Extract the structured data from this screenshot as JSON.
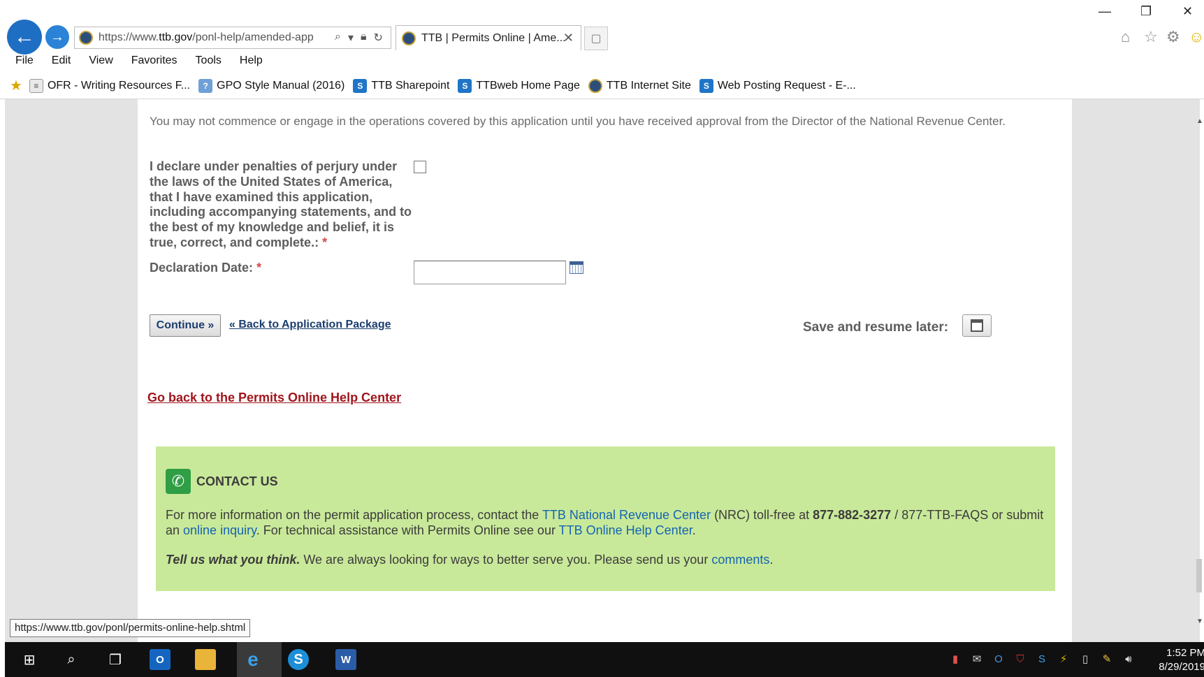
{
  "browser": {
    "url_prefix": "https://www.",
    "url_domain": "ttb.gov",
    "url_rest": "/ponl-help/amended-app",
    "tab_title": "TTB | Permits Online | Ame...",
    "tab_close": "✕",
    "menu": [
      "File",
      "Edit",
      "View",
      "Favorites",
      "Tools",
      "Help"
    ],
    "favorites": [
      {
        "label": "OFR - Writing Resources F...",
        "icon": "page-icon"
      },
      {
        "label": "GPO Style Manual (2016)",
        "icon": "gpo-icon"
      },
      {
        "label": "TTB Sharepoint",
        "icon": "sharepoint-icon"
      },
      {
        "label": "TTBweb Home Page",
        "icon": "sharepoint-icon"
      },
      {
        "label": "TTB Internet Site",
        "icon": "ttb-seal-icon"
      },
      {
        "label": "Web Posting Request - E-...",
        "icon": "sharepoint-icon"
      }
    ]
  },
  "form": {
    "notice": "You may not commence or engage in the operations covered by this application until you have received approval from the Director of the National Revenue Center.",
    "declaration": "I declare under penalties of perjury under the laws of the United States of America, that I have examined this application, including accompanying statements, and to the best of my knowledge and belief, it is true, correct, and complete.:",
    "required_mark": "*",
    "declaration_checked": false,
    "date_label": "Declaration Date:",
    "date_value": "",
    "continue_label": "Continue »",
    "back_link": "« Back to Application Package",
    "save_label": "Save and resume later:"
  },
  "help_link": "Go back to the Permits Online Help Center",
  "contact": {
    "title": "CONTACT US",
    "p1_before": "For more information on the permit application process, contact the ",
    "p1_link1": "TTB National Revenue Center",
    "p1_mid1": " (NRC) toll-free at ",
    "p1_phone": "877-882-3277",
    "p1_mid2": " / 877-TTB-FAQS or submit an ",
    "p1_link2": "online inquiry",
    "p1_mid3": ". For technical assistance with Permits Online see our ",
    "p1_link3": "TTB Online Help Center",
    "p1_end": ".",
    "p2_bold": "Tell us what you think.",
    "p2_mid": " We are always looking for ways to better serve you. Please send us your ",
    "p2_link": "comments",
    "p2_end": "."
  },
  "status_url": "https://www.ttb.gov/ponl/permits-online-help.shtml",
  "taskbar": {
    "time": "1:52 PM",
    "date": "8/29/2019"
  },
  "colors": {
    "contact_bg": "#c9e99a",
    "link_blue": "#1465b0",
    "help_link_red": "#a0151c",
    "button_text": "#1b3d6e"
  }
}
